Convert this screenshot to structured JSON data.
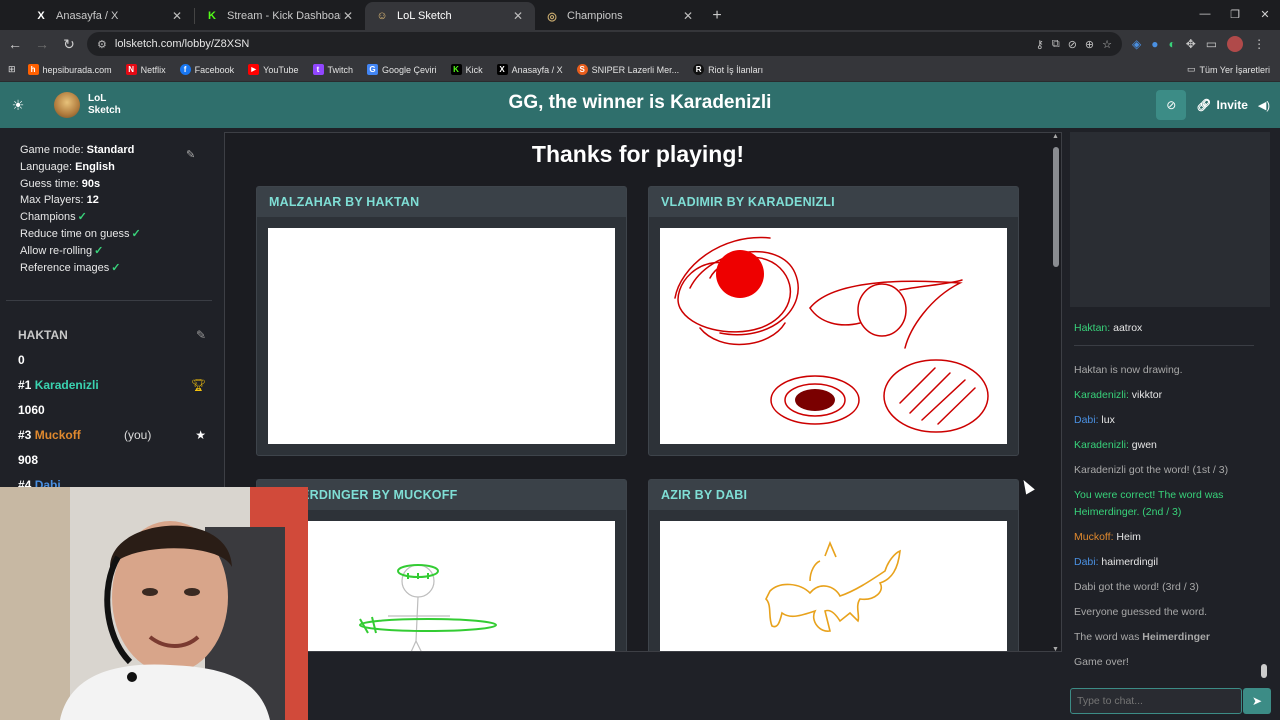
{
  "browser": {
    "tabs": [
      {
        "title": "Anasayfa / X",
        "icon": "x-logo-icon",
        "icon_text": "X",
        "color": "#ffffff",
        "active": false
      },
      {
        "title": "Stream - Kick Dashboard",
        "icon": "kick-logo-icon",
        "icon_text": "K",
        "color": "#53fc18",
        "active": false
      },
      {
        "title": "LoL Sketch",
        "icon": "lolsketch-logo-icon",
        "icon_text": "☺",
        "color": "#e8c27a",
        "active": true
      },
      {
        "title": "Champions",
        "icon": "champions-icon",
        "icon_text": "◎",
        "color": "#c8aa6e",
        "active": false
      }
    ],
    "url": "lolsketch.com/lobby/Z8XSN",
    "bookmarks": [
      {
        "label": "hepsiburada.com",
        "color": "#ff6000",
        "text": "h"
      },
      {
        "label": "Netflix",
        "color": "#e50914",
        "text": "N"
      },
      {
        "label": "Facebook",
        "color": "#1877f2",
        "text": "f"
      },
      {
        "label": "YouTube",
        "color": "#ff0000",
        "text": "▶"
      },
      {
        "label": "Twitch",
        "color": "#9146ff",
        "text": "t"
      },
      {
        "label": "Google Çeviri",
        "color": "#4285f4",
        "text": "G"
      },
      {
        "label": "Kick",
        "color": "#53fc18",
        "text": "K"
      },
      {
        "label": "Anasayfa / X",
        "color": "#000000",
        "text": "X"
      },
      {
        "label": "SNIPER Lazerli Mer...",
        "color": "#e85d1c",
        "text": "S"
      },
      {
        "label": "Riot İş İlanları",
        "color": "#111111",
        "text": "R"
      }
    ],
    "all_bookmarks": "Tüm Yer İşaretleri"
  },
  "header": {
    "logo_line1": "LoL",
    "logo_line2": "Sketch",
    "title": "GG, the winner is Karadenizli",
    "invite_label": "Invite"
  },
  "settings": {
    "game_mode_label": "Game mode:",
    "game_mode": "Standard",
    "language_label": "Language:",
    "language": "English",
    "guess_time_label": "Guess time:",
    "guess_time": "90s",
    "max_players_label": "Max Players:",
    "max_players": "12",
    "champions": "Champions",
    "reduce_time": "Reduce time on guess",
    "allow_rerolling": "Allow re-rolling",
    "reference_images": "Reference images",
    "check": "✓"
  },
  "players": {
    "p0": {
      "rank": "",
      "name": "HAKTAN",
      "score": "0",
      "color": "#c9c9c9"
    },
    "p1": {
      "rank": "#1",
      "name": "Karadenizli",
      "score": "1060",
      "color": "#3ad3b0"
    },
    "p2": {
      "rank": "#3",
      "name": "Muckoff",
      "score": "908",
      "color": "#e0892e",
      "you": "(you)"
    },
    "p3": {
      "rank": "#4",
      "name": "Dabi",
      "score": "",
      "color": "#4a90e2"
    }
  },
  "stage": {
    "thanks": "Thanks for playing!",
    "cards": [
      {
        "title": "MALZAHAR BY HAKTAN"
      },
      {
        "title": "VLADIMIR BY KARADENIZLI"
      },
      {
        "title": "HEIMERDINGER BY MUCKOFF"
      },
      {
        "title": "AZIR BY DABI"
      }
    ]
  },
  "chat": {
    "top_msg": {
      "user": "Haktan:",
      "text": " aatrox"
    },
    "messages": [
      {
        "type": "sys",
        "text": "Haktan is now drawing."
      },
      {
        "type": "user",
        "user": "Karadenizli:",
        "text": " vikktor"
      },
      {
        "type": "user",
        "user": "Dabi:",
        "text": " lux"
      },
      {
        "type": "user",
        "user": "Karadenizli:",
        "text": " gwen"
      },
      {
        "type": "sys",
        "text": "Karadenizli got the word! (1st / 3)"
      },
      {
        "type": "correct",
        "text": "You were correct! The word was Heimerdinger. (2nd / 3)"
      },
      {
        "type": "user",
        "user": "Muckoff:",
        "text": " Heim"
      },
      {
        "type": "user",
        "user": "Dabi:",
        "text": " haimerdingil"
      },
      {
        "type": "sys",
        "text": "Dabi got the word! (3rd / 3)"
      },
      {
        "type": "sys",
        "text": "Everyone guessed the word."
      },
      {
        "type": "sys",
        "text": "The word was ",
        "bold": "Heimerdinger"
      },
      {
        "type": "sys",
        "text": "Game over!"
      }
    ],
    "placeholder": "Type to chat..."
  },
  "colors": {
    "header_bg": "#2f6f6c",
    "accent": "#3c8c86",
    "card_title": "#7fded5",
    "user_karadenizli": "#38d27a",
    "user_dabi": "#4a90e2",
    "user_muckoff": "#e0892e",
    "user_haktan": "#38d27a"
  }
}
